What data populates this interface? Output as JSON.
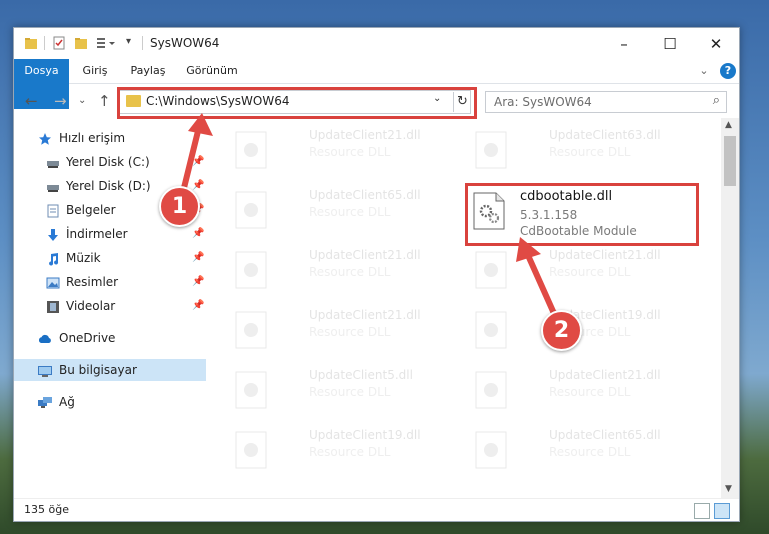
{
  "window": {
    "title": "SysWOW64",
    "controls": {
      "minimize": "–",
      "maximize": "☐",
      "close": "✕"
    }
  },
  "ribbon": {
    "tabs": [
      "Dosya",
      "Giriş",
      "Paylaş",
      "Görünüm"
    ],
    "expand": "⌄",
    "help": "?"
  },
  "nav": {
    "back": "←",
    "forward": "→",
    "recent": "⌄",
    "up": "↑",
    "address": "C:\\Windows\\SysWOW64",
    "address_dropdown": "⌄",
    "refresh": "↻",
    "search_placeholder": "Ara: SysWOW64",
    "search_icon": "⌕"
  },
  "sidebar": {
    "items": [
      {
        "label": "Hızlı erişim",
        "icon": "star-icon",
        "pinned": false
      },
      {
        "label": "Yerel Disk (C:)",
        "icon": "drive-icon",
        "pinned": true
      },
      {
        "label": "Yerel Disk (D:)",
        "icon": "drive-icon",
        "pinned": true
      },
      {
        "label": "Belgeler",
        "icon": "documents-icon",
        "pinned": true
      },
      {
        "label": "İndirmeler",
        "icon": "downloads-icon",
        "pinned": true
      },
      {
        "label": "Müzik",
        "icon": "music-icon",
        "pinned": true
      },
      {
        "label": "Resimler",
        "icon": "pictures-icon",
        "pinned": true
      },
      {
        "label": "Videolar",
        "icon": "videos-icon",
        "pinned": true
      },
      {
        "label": "OneDrive",
        "icon": "cloud-icon",
        "pinned": false
      },
      {
        "label": "Bu bilgisayar",
        "icon": "computer-icon",
        "pinned": false,
        "selected": true
      },
      {
        "label": "Ağ",
        "icon": "network-icon",
        "pinned": false
      }
    ],
    "pin_glyph": "📌"
  },
  "files": {
    "left_column": [
      {
        "name": "UpdateClient21.dll",
        "desc": "Resource DLL"
      },
      {
        "name": "UpdateClient65.dll",
        "desc": "Resource DLL"
      },
      {
        "name": "UpdateClient21.dll",
        "desc": "Resource DLL"
      },
      {
        "name": "UpdateClient21.dll",
        "desc": "Resource DLL"
      },
      {
        "name": "UpdateClient5.dll",
        "desc": "Resource DLL"
      },
      {
        "name": "UpdateClient19.dll",
        "desc": "Resource DLL"
      }
    ],
    "right_column": [
      {
        "name": "UpdateClient63.dll",
        "desc": "Resource DLL"
      },
      {
        "name": "UpdateClient21.dll",
        "desc": "Resource DLL"
      },
      {
        "name": "UpdateClient19.dll",
        "desc": "Resource DLL"
      },
      {
        "name": "UpdateClient21.dll",
        "desc": "Resource DLL"
      },
      {
        "name": "UpdateClient65.dll",
        "desc": "Resource DLL"
      }
    ],
    "selected": {
      "name": "cdbootable.dll",
      "version": "5.3.1.158",
      "desc": "CdBootable Module"
    }
  },
  "status": {
    "count": "135 öğe"
  },
  "annotations": {
    "badge1": "1",
    "badge2": "2",
    "color": "#e04a44"
  }
}
